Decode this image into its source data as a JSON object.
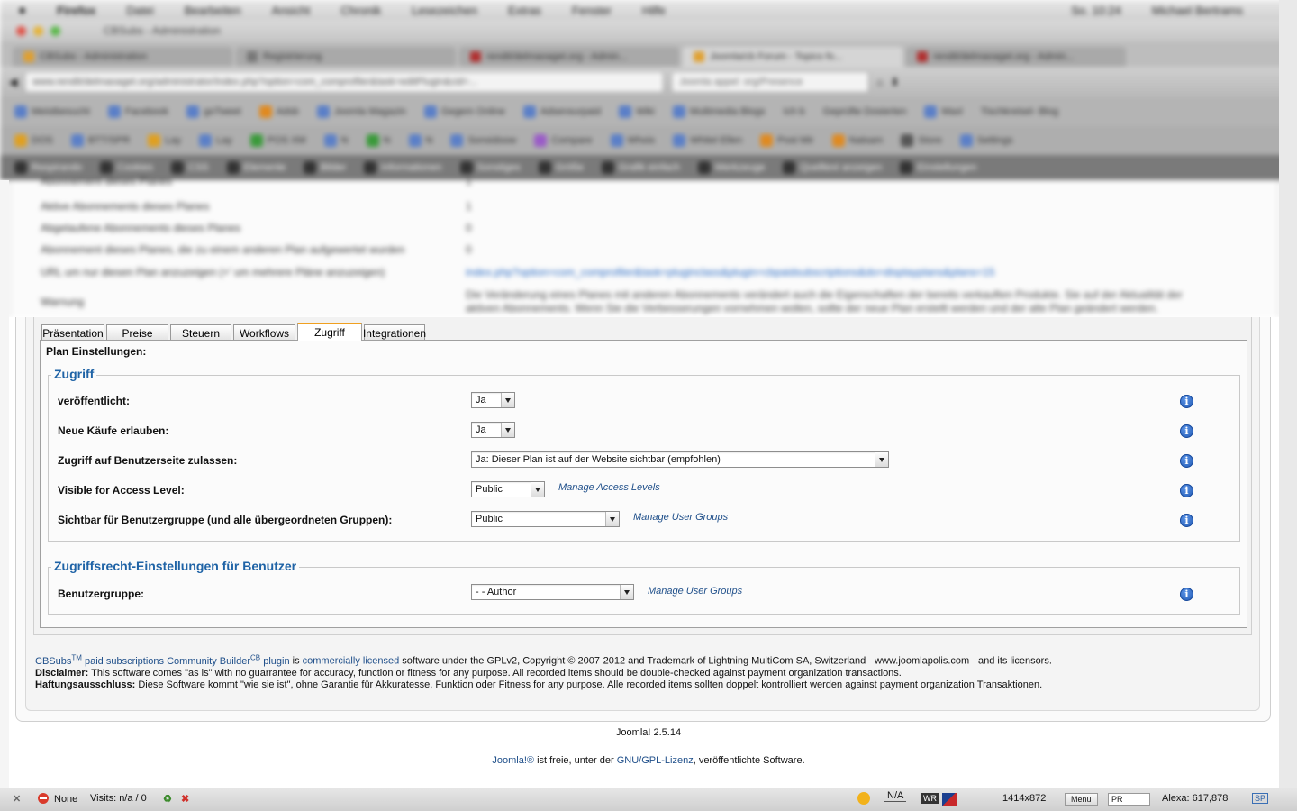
{
  "browser": {
    "menu_items": [
      "Firefox",
      "Datei",
      "Bearbeiten",
      "Ansicht",
      "Chronik",
      "Lesezeichen",
      "Extras",
      "Fenster",
      "Hilfe"
    ],
    "clock": "So. 10:24",
    "user": "Michael Bertrams",
    "window_title": "CBSubs - Administration",
    "tabs": [
      "Registrierung",
      "rendit/delmaoaget.org - Admin...",
      "Joomla/cb Forum - Topics fo...",
      "rendit/delmaoaget.org - Admin..."
    ],
    "url": "www.rendit/delmaoaget.org/administrator/index.php?option=com_comprofiler&task=editPlugin&cid=...",
    "search_placeholder": "Joomla appel: org/Presence",
    "bookmarks_row1": [
      "Meistbesucht",
      "Facebook",
      "goTweet",
      "Adsb",
      "Joomla Magazin",
      "Gegem Online",
      "Adsensurpaid",
      "Wiki",
      "Multimedia Blogs",
      "Ich b",
      "Geprüfte Dosierten",
      "Maxl",
      "Tischkreisel- Blog"
    ],
    "bookmarks_row2": [
      "DOS",
      "BTT/SPR",
      "Lay",
      "Lay",
      "POS XM",
      "N",
      "N",
      "N",
      "Sonsidoow",
      "Compare",
      "Whois",
      "Whitel Ellen",
      "Post Mir",
      "Natsam",
      "Store",
      "Settings"
    ],
    "bookmarks_row3": [
      "Respirando",
      "Cookies",
      "CSS",
      "Elemente",
      "Bilder",
      "Informationen",
      "Sonstiges",
      "Größe",
      "Grafik einfach",
      "Werkzeuge",
      "Quelltext anzeigen",
      "Einstellungen"
    ]
  },
  "background_rows": [
    {
      "label": "Abonnement dieses Planes",
      "value": "1"
    },
    {
      "label": "Aktive Abonnements dieses Planes",
      "value": "1"
    },
    {
      "label": "Abgelaufene Abonnements dieses Planes",
      "value": "0"
    },
    {
      "label": "Abonnement dieses Planes, die zu einem anderen Plan aufgewertet wurden",
      "value": "0"
    },
    {
      "label": "URL um nur diesen Plan anzuzeigen (+' um mehrere Pläne anzuzeigen)",
      "value": "index.php?option=com_comprofiler&task=pluginclass&plugin=cbpaidsubscriptions&do=displayplans&plans=15"
    },
    {
      "label": "Warnung",
      "value": "Die Veränderung eines Planes mit anderen Abonnements verändert auch die Eigenschaften der bereits verkauften Produkte. Sie auf der Aktualität der aktiven Abonnements. Wenn Sie die Verbesserungen vornehmen wollen, sollte der neue Plan erstellt werden und der alte Plan geändert werden."
    }
  ],
  "tabs": [
    "Präsentation",
    "Preise",
    "Steuern",
    "Workflows",
    "Zugriff",
    "Integrationen"
  ],
  "active_tab": "Zugriff",
  "plan_settings_label": "Plan Einstellungen:",
  "access": {
    "legend": "Zugriff",
    "published": {
      "label": "veröffentlicht:",
      "value": "Ja"
    },
    "allow_new_purchases": {
      "label": "Neue Käufe erlauben:",
      "value": "Ja"
    },
    "user_page_access": {
      "label": "Zugriff auf Benutzerseite zulassen:",
      "value": "Ja: Dieser Plan ist auf der Website sichtbar (empfohlen)"
    },
    "visible_access_level": {
      "label": "Visible for Access Level:",
      "value": "Public",
      "link": "Manage Access Levels"
    },
    "visible_user_group": {
      "label": "Sichtbar für Benutzergruppe (und alle übergeordneten Gruppen):",
      "value": "Public",
      "link": "Manage User Groups"
    }
  },
  "user_rights": {
    "legend": "Zugriffsrecht-Einstellungen für Benutzer",
    "user_group": {
      "label": "Benutzergruppe:",
      "value": "- - Author",
      "link": "Manage User Groups"
    }
  },
  "info_icon": "i",
  "footer": {
    "product": "CBSubs",
    "tm": "TM",
    "paid_text": "paid subscriptions Community Builder",
    "cb": "CB",
    "plugin": "plugin",
    "is": "is",
    "licensed": "commercially licensed",
    "rest": "software under the GPLv2, Copyright © 2007-2012 and Trademark of Lightning MultiCom SA, Switzerland - www.joomlapolis.com - and its licensors.",
    "disclaimer_label": "Disclaimer:",
    "disclaimer": "This software comes \"as is\" with no guarrantee for accuracy, function or fitness for any purpose. All recorded items should be double-checked against payment organization transactions.",
    "haftung_label": "Haftungsausschluss:",
    "haftung": "Diese Software kommt \"wie sie ist\", ohne Garantie für Akkuratesse, Funktion oder Fitness for any purpose. Alle recorded items sollten doppelt kontrolliert werden against payment organization Transaktionen."
  },
  "joomla": {
    "version": "Joomla! 2.5.14",
    "link1": "Joomla!®",
    "mid": "ist freie, unter der",
    "link2": "GNU/GPL-Lizenz",
    "end": ", veröffentlichte Software."
  },
  "statusbar": {
    "close": "✕",
    "none": "None",
    "visits": "Visits: n/a / 0",
    "na": "N/A",
    "wr": "WR",
    "size": "1414x872",
    "menu": "Menu",
    "pr": "PR",
    "alexa": "Alexa: 617,878",
    "sp": "SP"
  }
}
